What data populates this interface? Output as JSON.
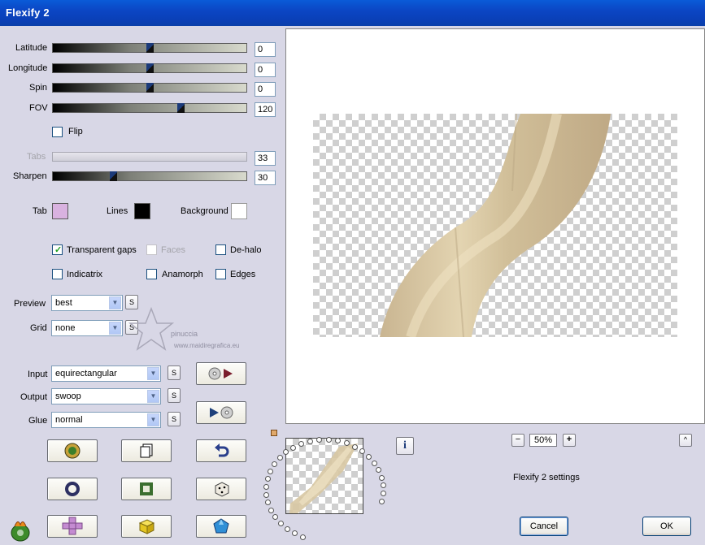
{
  "window": {
    "title": "Flexify 2"
  },
  "sliders": [
    {
      "label": "Latitude",
      "value": "0",
      "position": 0.5
    },
    {
      "label": "Longitude",
      "value": "0",
      "position": 0.5
    },
    {
      "label": "Spin",
      "value": "0",
      "position": 0.5
    },
    {
      "label": "FOV",
      "value": "120",
      "position": 0.67
    }
  ],
  "flip": {
    "label": "Flip",
    "checked": false
  },
  "tabs": {
    "label": "Tabs",
    "value": "33"
  },
  "sharpen": {
    "label": "Sharpen",
    "value": "30",
    "position": 0.31
  },
  "colors": {
    "tab": {
      "label": "Tab",
      "color": "#d9b2e0"
    },
    "lines": {
      "label": "Lines",
      "color": "#000000"
    },
    "background": {
      "label": "Background",
      "color": "#ffffff"
    }
  },
  "options": {
    "transparent_gaps": {
      "label": "Transparent gaps",
      "checked": true
    },
    "faces": {
      "label": "Faces",
      "checked": false
    },
    "dehalo": {
      "label": "De-halo",
      "checked": false
    },
    "indicatrix": {
      "label": "Indicatrix",
      "checked": false
    },
    "anamorph": {
      "label": "Anamorph",
      "checked": false
    },
    "edges": {
      "label": "Edges",
      "checked": false
    }
  },
  "preview_select": {
    "label": "Preview",
    "value": "best"
  },
  "grid_select": {
    "label": "Grid",
    "value": "none"
  },
  "input_select": {
    "label": "Input",
    "value": "equirectangular"
  },
  "output_select": {
    "label": "Output",
    "value": "swoop"
  },
  "glue_select": {
    "label": "Glue",
    "value": "normal"
  },
  "small_button_label": "S",
  "zoom": {
    "value": "50%",
    "minus": "−",
    "plus": "+"
  },
  "info_icon": "i",
  "up_button": "^",
  "settings_label": "Flexify 2 settings",
  "watermark": {
    "line1": "pinuccia",
    "line2": "www.maidiregrafica.eu"
  },
  "buttons": {
    "cancel": "Cancel",
    "ok": "OK"
  },
  "accent_colors": {
    "title_bar": "#0a46c4",
    "panel": "#d8d7e6",
    "swoop": "#d3c3a0"
  }
}
